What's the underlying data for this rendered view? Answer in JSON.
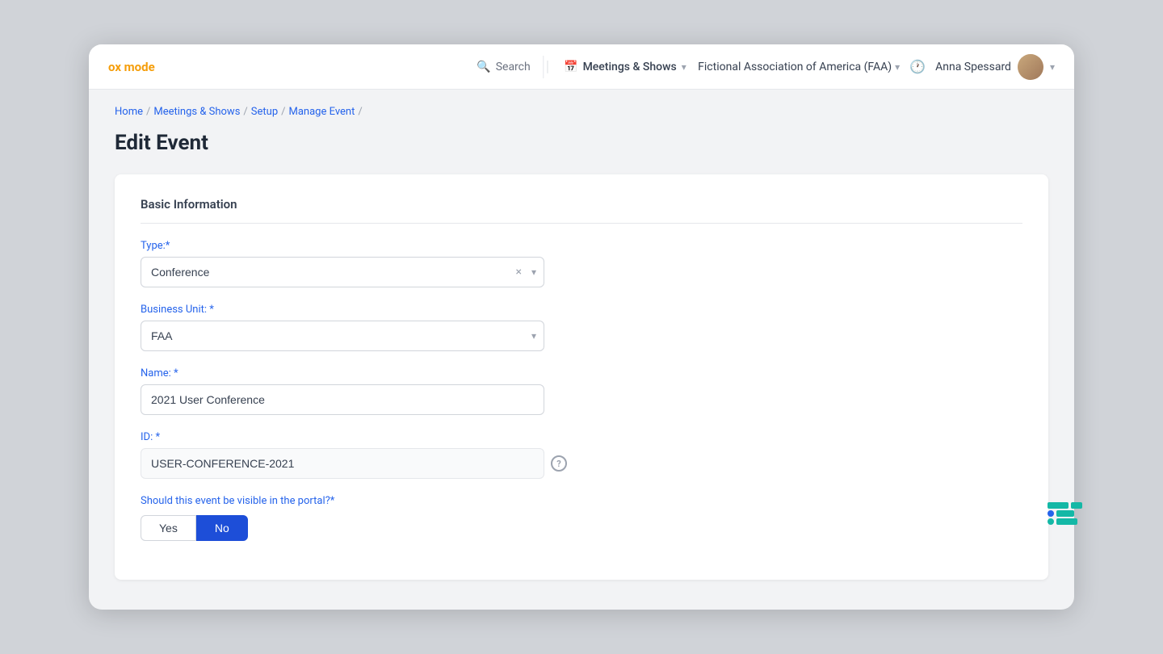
{
  "app": {
    "logo": "ox mode"
  },
  "navbar": {
    "search_label": "Search",
    "meetings_label": "Meetings & Shows",
    "org_label": "Fictional Association of America (FAA)",
    "user_name": "Anna Spessard"
  },
  "breadcrumb": {
    "home": "Home",
    "meetings": "Meetings & Shows",
    "setup": "Setup",
    "manage_event": "Manage Event",
    "separator": "/"
  },
  "page": {
    "title": "Edit Event"
  },
  "form": {
    "card_title": "Basic Information",
    "type_label": "Type:*",
    "type_value": "Conference",
    "type_clear": "×",
    "business_unit_label": "Business Unit: *",
    "business_unit_value": "FAA",
    "name_label": "Name: *",
    "name_value": "2021 User Conference",
    "id_label": "ID: *",
    "id_value": "USER-CONFERENCE-2021",
    "visibility_label": "Should this event be visible in the portal?*",
    "yes_label": "Yes",
    "no_label": "No"
  }
}
